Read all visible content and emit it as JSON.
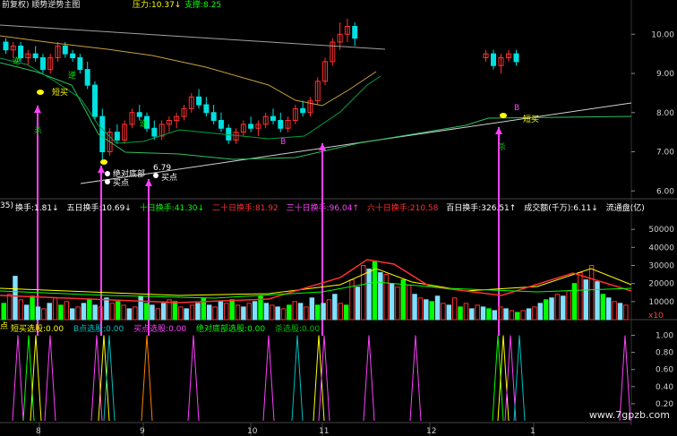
{
  "header": {
    "title": "前复权) 顺势逆势主图",
    "pressure": "压力:10.37↓",
    "support": "支撑:8.25"
  },
  "indicator_bar": {
    "prefix": "35)",
    "items": [
      {
        "text": "换手:1.81↓",
        "color": "#ffffff"
      },
      {
        "text": "五日换手:10.69↓",
        "color": "#ffffff"
      },
      {
        "text": "十日换手:41.30↓",
        "color": "#00ff00"
      },
      {
        "text": "二十日换手:81.92",
        "color": "#ff3030"
      },
      {
        "text": "三十日换手:96.04↑",
        "color": "#ff40ff"
      },
      {
        "text": "六十日换手:210.58",
        "color": "#ff3030"
      },
      {
        "text": "百日换手:326.51↑",
        "color": "#ffffff"
      },
      {
        "text": "成交额(千万):6.11↓",
        "color": "#ffffff"
      },
      {
        "text": "流通盘(亿)",
        "color": "#ffffff"
      }
    ]
  },
  "signal_bar": {
    "prefix": "点",
    "items": [
      {
        "text": "短买选股:0.00",
        "color": "#ffff00"
      },
      {
        "text": "B点选股:0.00",
        "color": "#00c0c0"
      },
      {
        "text": "买点选股:0.00",
        "color": "#ff40ff"
      },
      {
        "text": "绝对底部选股:0.00",
        "color": "#00ff00"
      },
      {
        "text": "杀选股:0.00",
        "color": "#00c000"
      }
    ]
  },
  "annotations": [
    {
      "text": "逆",
      "color": "#00ff00"
    },
    {
      "text": "逆",
      "color": "#00ff00"
    },
    {
      "text": "短买",
      "color": "#ffff00"
    },
    {
      "text": "杀",
      "color": "#00c000"
    },
    {
      "text": "绝对底部",
      "color": "#ffffff"
    },
    {
      "text": "6.79",
      "color": "#ffffff"
    },
    {
      "text": "买点",
      "color": "#ffffff"
    },
    {
      "text": "买点",
      "color": "#ffffff"
    },
    {
      "text": "逆",
      "color": "#00ff00"
    },
    {
      "text": "B",
      "color": "#ff40ff"
    },
    {
      "text": "B",
      "color": "#ff40ff"
    },
    {
      "text": "短买",
      "color": "#ffff00"
    },
    {
      "text": "杀",
      "color": "#00c000"
    },
    {
      "text": "x10",
      "color": "#ff4040"
    }
  ],
  "watermark": "www.7gpzb.com",
  "chart_data": [
    {
      "type": "candlestick",
      "ylim": [
        5.8,
        10.6
      ],
      "y_ticks": [
        "10.00",
        "9.00",
        "8.00",
        "7.00",
        "6.00"
      ],
      "y_tick_values": [
        10.0,
        9.0,
        8.0,
        7.0,
        6.0
      ],
      "candles": [
        [
          9.8,
          9.9,
          9.5,
          9.6
        ],
        [
          9.6,
          9.8,
          9.4,
          9.7
        ],
        [
          9.7,
          9.8,
          9.3,
          9.4
        ],
        [
          9.4,
          9.6,
          9.2,
          9.5
        ],
        [
          9.5,
          9.7,
          9.3,
          9.4
        ],
        [
          9.4,
          9.5,
          9.0,
          9.1
        ],
        [
          9.1,
          9.5,
          9.0,
          9.4
        ],
        [
          9.4,
          9.8,
          9.3,
          9.7
        ],
        [
          9.7,
          9.8,
          9.4,
          9.5
        ],
        [
          9.5,
          9.6,
          9.3,
          9.4
        ],
        [
          9.4,
          9.5,
          9.0,
          9.1
        ],
        [
          9.1,
          9.3,
          8.6,
          8.7
        ],
        [
          8.7,
          8.8,
          7.8,
          7.9
        ],
        [
          7.9,
          8.1,
          6.8,
          7.0
        ],
        [
          7.0,
          7.6,
          6.9,
          7.5
        ],
        [
          7.5,
          7.7,
          7.2,
          7.3
        ],
        [
          7.3,
          7.8,
          7.2,
          7.7
        ],
        [
          7.7,
          8.1,
          7.6,
          8.0
        ],
        [
          8.0,
          8.2,
          7.8,
          7.9
        ],
        [
          7.9,
          8.0,
          7.5,
          7.6
        ],
        [
          7.6,
          7.8,
          7.3,
          7.4
        ],
        [
          7.4,
          7.8,
          7.3,
          7.7
        ],
        [
          7.7,
          7.9,
          7.5,
          7.8
        ],
        [
          7.8,
          8.0,
          7.6,
          7.9
        ],
        [
          7.9,
          8.2,
          7.8,
          8.1
        ],
        [
          8.1,
          8.5,
          8.0,
          8.4
        ],
        [
          8.4,
          8.6,
          8.1,
          8.2
        ],
        [
          8.2,
          8.4,
          7.9,
          8.0
        ],
        [
          8.0,
          8.2,
          7.7,
          7.8
        ],
        [
          7.8,
          8.0,
          7.5,
          7.6
        ],
        [
          7.6,
          7.7,
          7.2,
          7.3
        ],
        [
          7.3,
          7.6,
          7.2,
          7.5
        ],
        [
          7.5,
          7.8,
          7.4,
          7.7
        ],
        [
          7.7,
          7.9,
          7.5,
          7.6
        ],
        [
          7.6,
          7.8,
          7.4,
          7.7
        ],
        [
          7.7,
          8.0,
          7.6,
          7.9
        ],
        [
          7.9,
          8.1,
          7.7,
          7.8
        ],
        [
          7.8,
          8.0,
          7.5,
          7.6
        ],
        [
          7.6,
          7.9,
          7.5,
          7.8
        ],
        [
          7.8,
          8.2,
          7.7,
          8.1
        ],
        [
          8.1,
          8.3,
          7.9,
          8.0
        ],
        [
          8.0,
          8.4,
          7.9,
          8.3
        ],
        [
          8.3,
          8.9,
          8.2,
          8.8
        ],
        [
          8.8,
          9.4,
          8.7,
          9.3
        ],
        [
          9.3,
          9.9,
          9.2,
          9.8
        ],
        [
          9.8,
          10.3,
          9.6,
          10.0
        ],
        [
          10.0,
          10.4,
          9.8,
          10.2
        ],
        [
          10.2,
          10.3,
          9.7,
          9.9
        ]
      ],
      "candles_right": [
        [
          9.4,
          9.6,
          9.3,
          9.5
        ],
        [
          9.5,
          9.6,
          9.1,
          9.2
        ],
        [
          9.2,
          9.5,
          9.0,
          9.4
        ],
        [
          9.4,
          9.6,
          9.3,
          9.5
        ],
        [
          9.5,
          9.6,
          9.2,
          9.3
        ]
      ]
    },
    {
      "type": "bar",
      "ylim": [
        0,
        60000
      ],
      "y_ticks": [
        "50000",
        "40000",
        "30000",
        "20000",
        "10000"
      ],
      "y_tick_values": [
        50000,
        40000,
        30000,
        20000,
        10000
      ],
      "values": [
        9000,
        14000,
        24000,
        11000,
        8000,
        13000,
        7000,
        6000,
        9000,
        12000,
        8000,
        10000,
        6000,
        7000,
        9000,
        11000,
        8000,
        7000,
        12000,
        9000,
        10000,
        8000,
        6000,
        7000,
        13000,
        9000,
        8000,
        6000,
        9000,
        11000,
        10000,
        7000,
        6000,
        8000,
        9000,
        12000,
        8000,
        7000,
        10000,
        9000,
        11000,
        8000,
        7000,
        9000,
        10000,
        13000,
        9000,
        8000,
        7000,
        6000,
        8000,
        10000,
        9000,
        7000,
        12000,
        8000,
        9000,
        11000,
        14000,
        9000,
        8000,
        22000,
        18000,
        30000,
        28000,
        32000,
        26000,
        25000,
        20000,
        18000,
        22000,
        19000,
        14000,
        12000,
        11000,
        10000,
        13000,
        9000,
        8000,
        12000,
        7000,
        9000,
        6000,
        8000,
        7000,
        6000,
        5000,
        7000,
        6000,
        5000,
        4000,
        5000,
        6000,
        7000,
        9000,
        11000,
        12000,
        14000,
        13000,
        16000,
        20000,
        26000,
        22000,
        30000,
        21000,
        14000,
        12000,
        10000,
        9000,
        8000
      ]
    },
    {
      "type": "line",
      "ylim": [
        0,
        1.1
      ],
      "y_ticks": [
        "1.00",
        "0.80",
        "0.60",
        "0.40",
        "0.20"
      ],
      "y_tick_values": [
        1.0,
        0.8,
        0.6,
        0.4,
        0.2
      ],
      "x_ticks": [
        "8",
        "9",
        "10",
        "11",
        "12",
        "1"
      ]
    }
  ]
}
